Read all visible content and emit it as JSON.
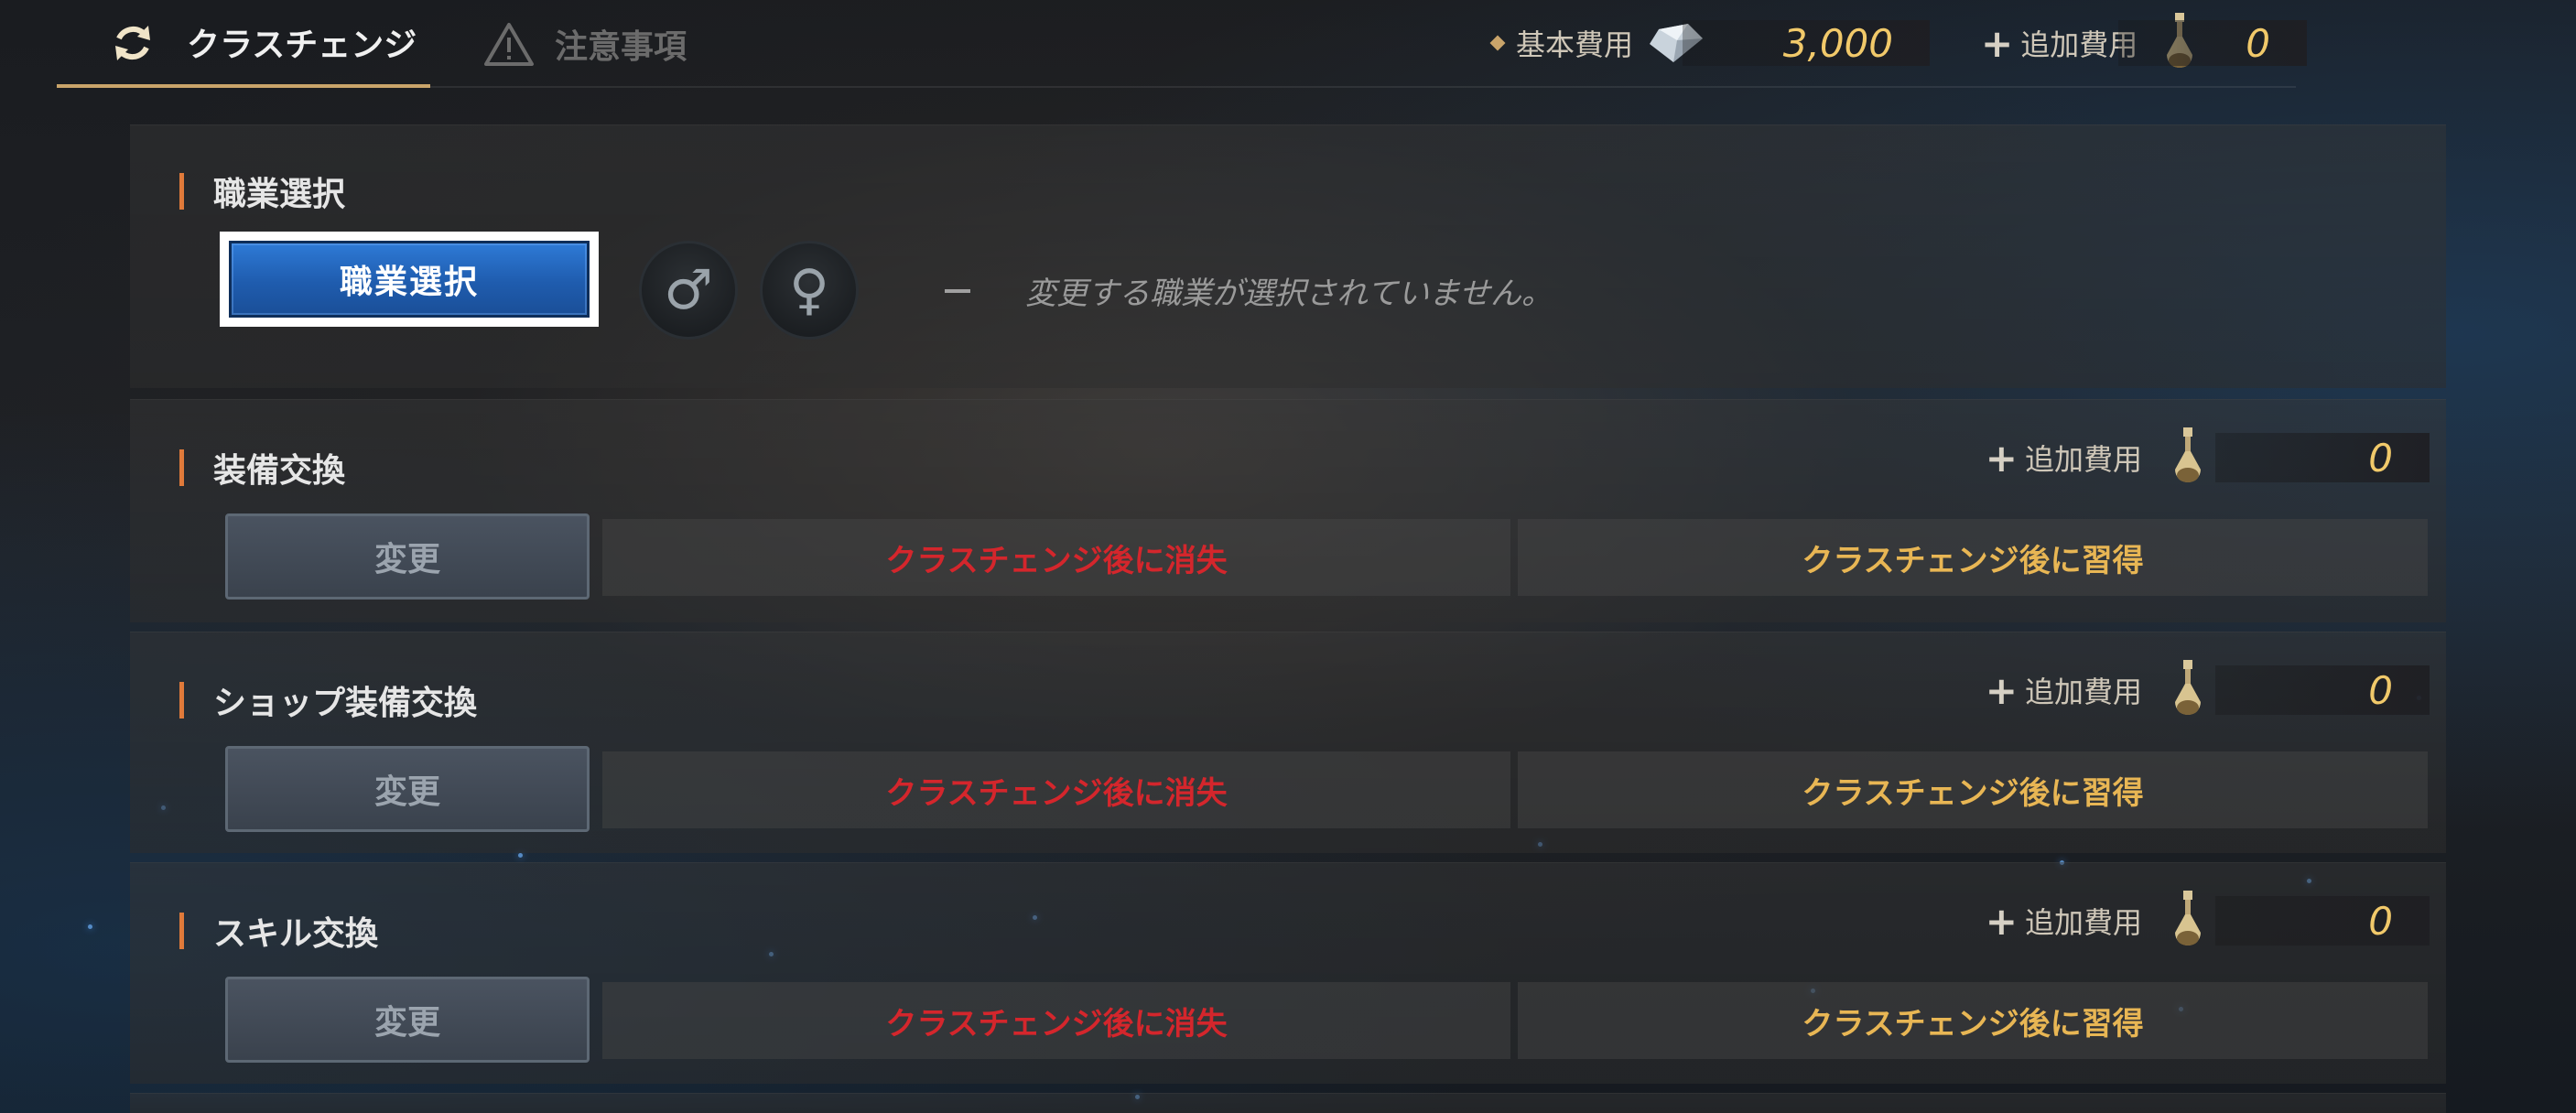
{
  "tabs": {
    "class_change": {
      "label": "クラスチェンジ",
      "icon": "refresh-icon"
    },
    "notes": {
      "label": "注意事項",
      "icon": "warning-icon"
    }
  },
  "costs": {
    "base_label": "基本費用",
    "base_value": "3,000",
    "add_label": "追加費用",
    "add_value": "0"
  },
  "sections": {
    "job": {
      "title": "職業選択",
      "button": "職業選択",
      "male_symbol": "♂",
      "female_symbol": "♀",
      "status": "変更する職業が選択されていません。"
    },
    "equipment": {
      "title": "装備交換",
      "button": "変更",
      "lose": "クラスチェンジ後に消失",
      "gain": "クラスチェンジ後に習得",
      "add_label": "追加費用",
      "add_value": "0"
    },
    "shop_equipment": {
      "title": "ショップ装備交換",
      "button": "変更",
      "lose": "クラスチェンジ後に消失",
      "gain": "クラスチェンジ後に習得",
      "add_label": "追加費用",
      "add_value": "0"
    },
    "skill": {
      "title": "スキル交換",
      "button": "変更",
      "lose": "クラスチェンジ後に消失",
      "gain": "クラスチェンジ後に習得",
      "add_label": "追加費用",
      "add_value": "0"
    }
  },
  "colors": {
    "lose_text": "#d4262c",
    "gain_text": "#e8b654",
    "cost_text": "#f1c96a",
    "accent_bar": "#e07a3a",
    "primary_button": "#2e7ad6"
  }
}
